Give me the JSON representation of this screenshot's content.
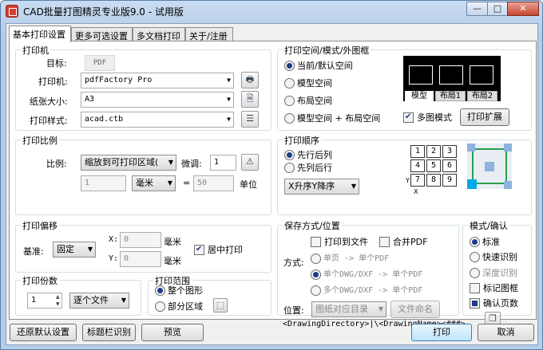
{
  "window": {
    "title": "CAD批量打图精灵专业版9.0 - 试用版",
    "min": "—",
    "max": "□",
    "close": "✕"
  },
  "tabs": [
    {
      "label": "基本打印设置"
    },
    {
      "label": "更多可选设置"
    },
    {
      "label": "多文档打印"
    },
    {
      "label": "关于/注册"
    }
  ],
  "printer": {
    "title": "打印机",
    "target_label": "目标:",
    "target_value": "PDF",
    "printer_label": "打印机:",
    "printer_value": "pdfFactory Pro",
    "paper_label": "纸张大小:",
    "paper_value": "A3",
    "style_label": "打印样式:",
    "style_value": "acad.ctb"
  },
  "space": {
    "title": "打印空间/模式/外图框",
    "options": [
      "当前/默认空间",
      "模型空间",
      "布局空间",
      "模型空间 + 布局空间"
    ],
    "selected": 0,
    "tabs": [
      "模型",
      "布局1",
      "布局2"
    ],
    "multi_label": "多图模式",
    "multi_checked": true,
    "expand_button": "打印扩展"
  },
  "scale": {
    "title": "打印比例",
    "ratio_label": "比例:",
    "ratio_value": "缩放到可打印区域(",
    "fine_label": "微调:",
    "fine_value": "1",
    "left_value": "1",
    "unit_value": "毫米",
    "eq": "=",
    "right_value": "50",
    "unit_label": "单位"
  },
  "order": {
    "title": "打印顺序",
    "options": [
      "先行后列",
      "先列后行"
    ],
    "selected": 0,
    "sort_value": "X升序Y降序",
    "grid": [
      "1",
      "2",
      "3",
      "4",
      "5",
      "6",
      "7",
      "8",
      "9"
    ],
    "axis_x": "X",
    "axis_y": "Y"
  },
  "offset": {
    "title": "打印偏移",
    "base_label": "基准:",
    "base_value": "固定",
    "x_label": "X:",
    "x_value": "0",
    "y_label": "Y:",
    "y_value": "0",
    "unit": "毫米",
    "center_label": "居中打印",
    "center_checked": true
  },
  "save": {
    "title": "保存方式/位置",
    "to_file": "打印到文件",
    "merge": "合并PDF",
    "mode_label": "方式:",
    "modes": [
      "单页 -> 单个PDF",
      "单个DWG/DXF -> 单个PDF",
      "多个DWG/DXF -> 单个PDF"
    ],
    "mode_selected": 1,
    "location_label": "位置:",
    "location_value": "图纸对应目录",
    "name_button": "文件命名",
    "path": "<DrawingDirectory>|\\<DrawingName><###>"
  },
  "confirm": {
    "title": "模式/确认",
    "options": [
      "标准",
      "快速识别",
      "深度识别"
    ],
    "selected": 0,
    "mark_frame": "标记图框",
    "confirm_pages": "确认页数"
  },
  "copies": {
    "title": "打印份数",
    "count": "1",
    "mode_value": "逐个文件"
  },
  "range": {
    "title": "打印范围",
    "options": [
      "整个图形",
      "部分区域"
    ],
    "selected": 0
  },
  "footer": {
    "restore": "还原默认设置",
    "titlebar": "标题栏识别",
    "preview": "预览",
    "print": "打印",
    "cancel": "取消"
  },
  "colors": {
    "accent": "#1f3b8a",
    "titlebar": "#b6cde8",
    "preview_bg": "#000000"
  }
}
